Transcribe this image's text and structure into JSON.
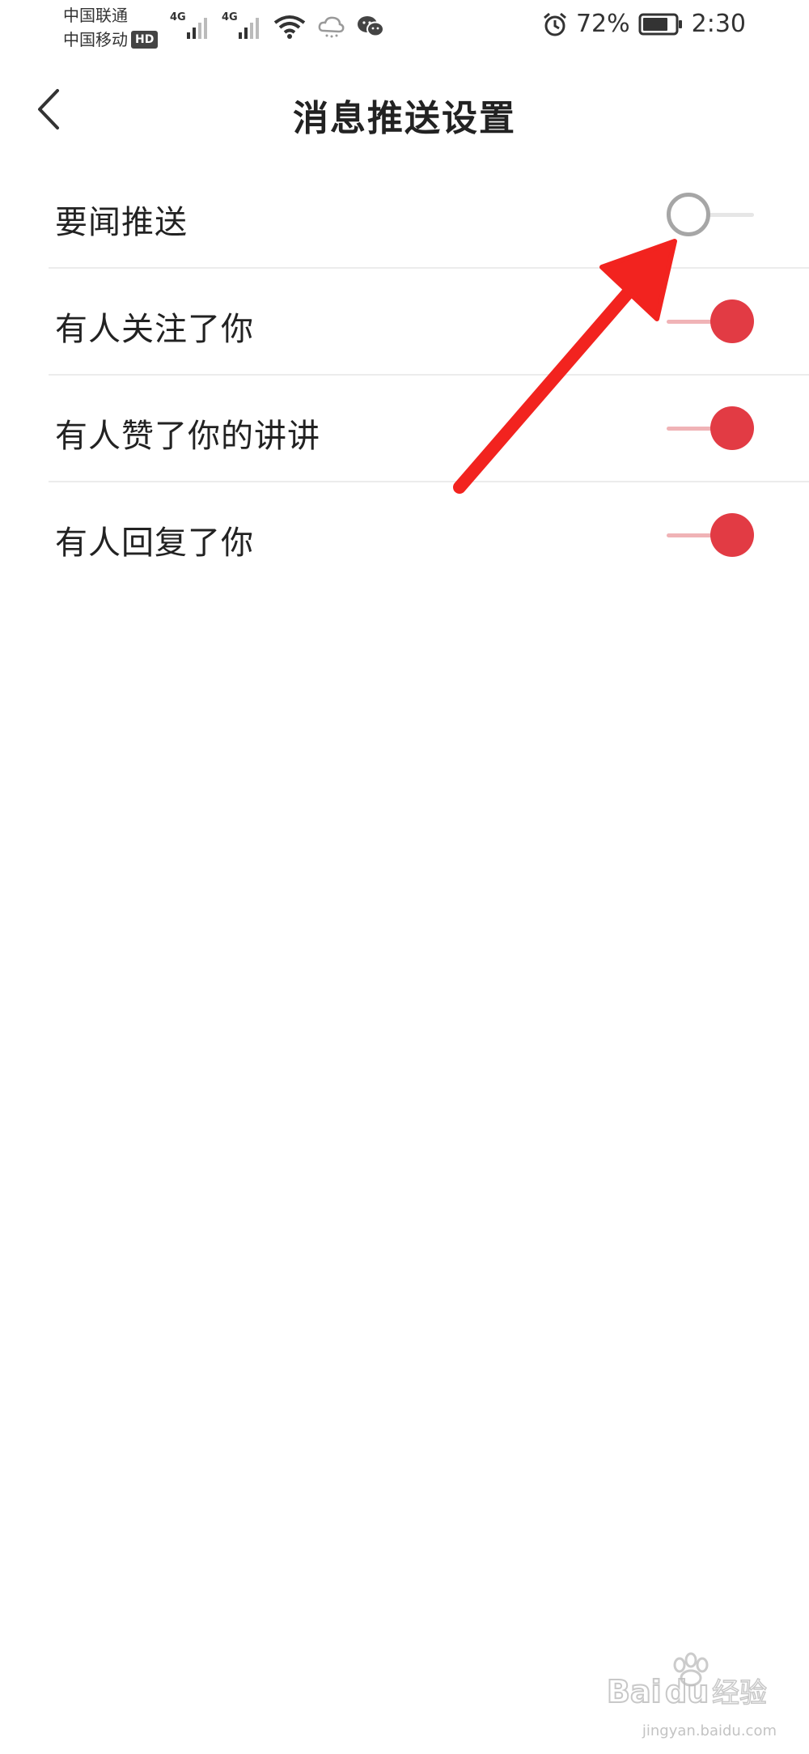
{
  "status_bar": {
    "carrier_1": "中国联通",
    "carrier_2": "中国移动",
    "hd_badge": "HD",
    "network_1": "4G",
    "network_2": "4G",
    "battery_percent": "72%",
    "time": "2:30",
    "icons": [
      "wifi-icon",
      "cloud-icon",
      "wechat-icon",
      "alarm-icon",
      "battery-icon"
    ]
  },
  "header": {
    "title": "消息推送设置",
    "back_icon": "chevron-left-icon"
  },
  "settings": [
    {
      "label": "要闻推送",
      "enabled": false
    },
    {
      "label": "有人关注了你",
      "enabled": true
    },
    {
      "label": "有人赞了你的讲讲",
      "enabled": true
    },
    {
      "label": "有人回复了你",
      "enabled": true
    }
  ],
  "colors": {
    "accent": "#e23b44",
    "annotation_arrow": "#f2231f"
  },
  "watermark": {
    "brand": "Baidu经验",
    "url": "jingyan.baidu.com"
  }
}
